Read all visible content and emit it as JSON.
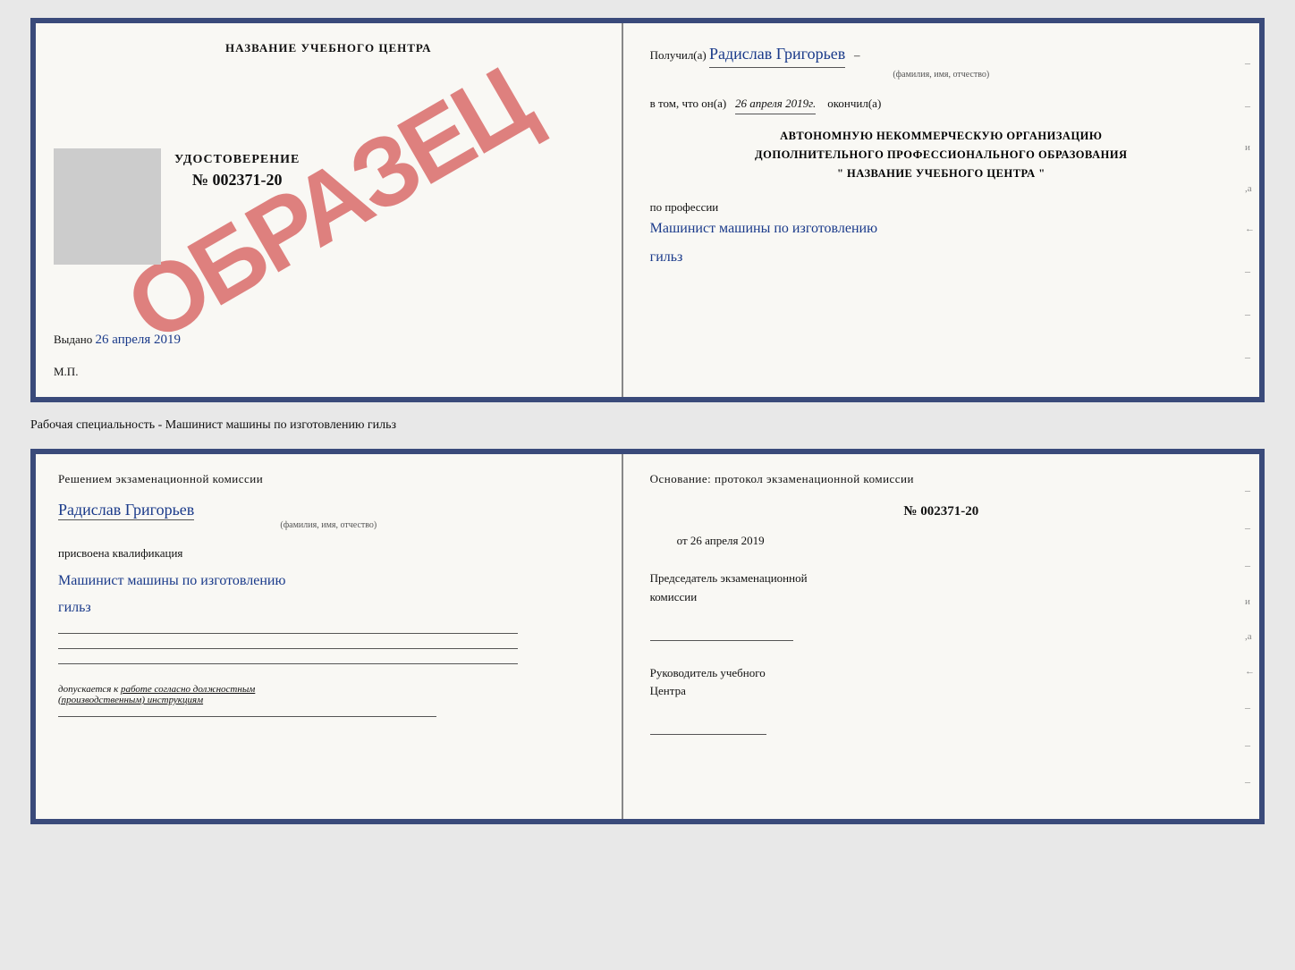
{
  "top_doc": {
    "left": {
      "edu_center": "НАЗВАНИЕ УЧЕБНОГО ЦЕНТРА",
      "watermark": "ОБРАЗЕЦ",
      "cert_label": "УДОСТОВЕРЕНИЕ",
      "cert_number": "№ 002371-20",
      "issued_prefix": "Выдано",
      "issued_date": "26 апреля 2019",
      "mp": "М.П."
    },
    "right": {
      "received_prefix": "Получил(а)",
      "person_name": "Радислав Григорьев",
      "name_sub": "(фамилия, имя, отчество)",
      "in_that_prefix": "в том, что он(а)",
      "completed_date": "26 апреля 2019г.",
      "completed_suffix": "окончил(а)",
      "org_line1": "АВТОНОМНУЮ НЕКОММЕРЧЕСКУЮ ОРГАНИЗАЦИЮ",
      "org_line2": "ДОПОЛНИТЕЛЬНОГО ПРОФЕССИОНАЛЬНОГО ОБРАЗОВАНИЯ",
      "org_line3": "\"  НАЗВАНИЕ УЧЕБНОГО ЦЕНТРА  \"",
      "profession_prefix": "по профессии",
      "profession_hw": "Машинист машины по изготовлению",
      "profession_hw2": "гильз"
    }
  },
  "middle": {
    "label": "Рабочая специальность - Машинист машины по изготовлению гильз"
  },
  "bottom_doc": {
    "left": {
      "commission_title": "Решением  экзаменационной  комиссии",
      "person_name": "Радислав Григорьев",
      "name_sub": "(фамилия, имя, отчество)",
      "qualification_assigned": "присвоена квалификация",
      "qualification_hw": "Машинист машины по изготовлению",
      "qualification_hw2": "гильз",
      "допускается_prefix": "допускается к",
      "допускается_text": "работе согласно должностным",
      "допускается_text2": "(производственным) инструкциям"
    },
    "right": {
      "foundation_label": "Основание: протокол экзаменационной комиссии",
      "protocol_number": "№  002371-20",
      "protocol_date_prefix": "от",
      "protocol_date": "26 апреля 2019",
      "chairman_label": "Председатель экзаменационной",
      "chairman_label2": "комиссии",
      "head_label": "Руководитель учебного",
      "head_label2": "Центра"
    }
  }
}
